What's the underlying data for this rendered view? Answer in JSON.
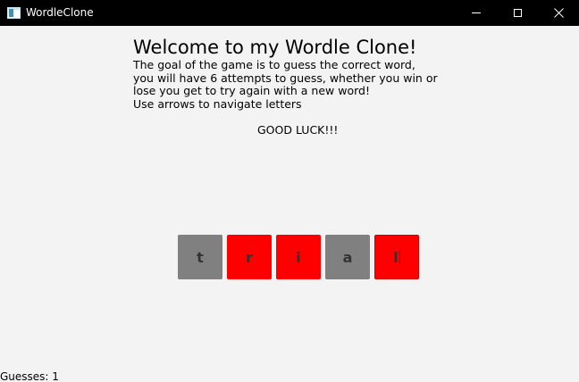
{
  "window": {
    "title": "WordleClone",
    "titlebar_color": "#000000",
    "background_color": "#f3f3f3",
    "icons": {
      "app": "app-window-icon",
      "minimize": "minimize-icon",
      "maximize": "maximize-icon",
      "close": "close-icon"
    }
  },
  "intro": {
    "heading": "Welcome to my Wordle Clone!",
    "lines": [
      "The goal of the game is to guess the correct word,",
      "you will have 6 attempts to guess, whether you win or",
      "lose you get to try again with a new word!",
      "Use arrows to navigate letters"
    ],
    "good_luck": "GOOD LUCK!!!"
  },
  "board": {
    "tiles": [
      {
        "letter": "t",
        "status": "absent",
        "color": "#808080"
      },
      {
        "letter": "r",
        "status": "wrong",
        "color": "#ff0000"
      },
      {
        "letter": "i",
        "status": "wrong",
        "color": "#ff0000"
      },
      {
        "letter": "a",
        "status": "absent",
        "color": "#808080"
      },
      {
        "letter": "l",
        "status": "wrong",
        "color": "#ff0000",
        "active": true
      }
    ]
  },
  "status": {
    "guesses": "Guesses: 1"
  }
}
